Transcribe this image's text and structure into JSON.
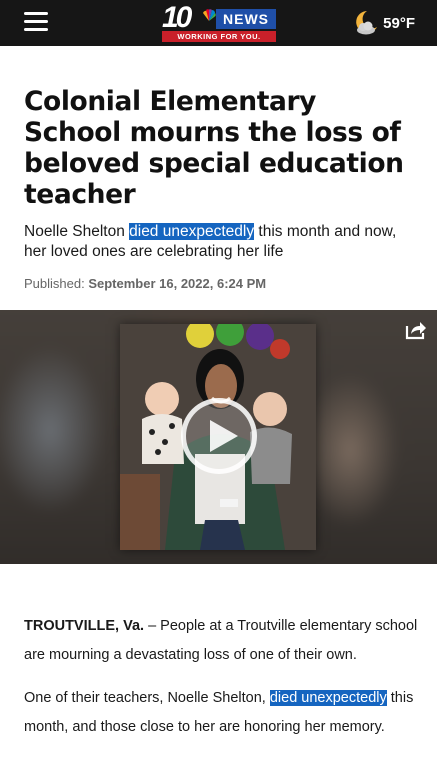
{
  "header": {
    "logo": {
      "number": "10",
      "news": "NEWS",
      "tagline": "WORKING FOR YOU."
    },
    "weather": {
      "icon": "moon-cloud-icon",
      "temp": "59°F"
    }
  },
  "article": {
    "headline": "Colonial Elementary School mourns the loss of beloved special education teacher",
    "subhead": {
      "before": "Noelle Shelton ",
      "highlight": "died unexpectedly",
      "after": " this month and now, her loved ones are celebrating her life"
    },
    "published_label": "Published:",
    "published_date": "September 16, 2022, 6:24 PM",
    "paragraphs": {
      "p1": {
        "dateline": "TROUTVILLE, Va.",
        "text": " – People at a Troutville elementary school are mourning a devastating loss of one of their own."
      },
      "p2": {
        "before": "One of their teachers, Noelle Shelton, ",
        "highlight": "died unexpectedly",
        "after": " this month, and those close to her are honoring her memory."
      }
    }
  },
  "colors": {
    "header_bg": "#161616",
    "news_blue": "#1f4fa8",
    "tag_red": "#c9202a",
    "highlight": "#1565c0"
  }
}
